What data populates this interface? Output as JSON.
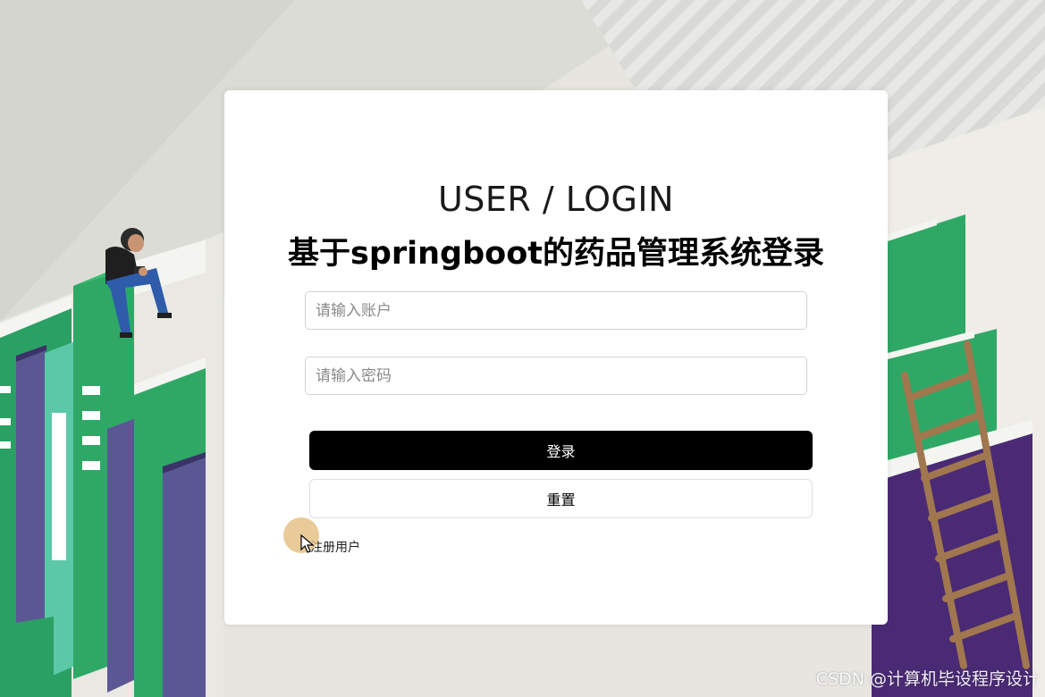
{
  "login": {
    "title": "USER / LOGIN",
    "subtitle": "基于springboot的药品管理系统登录",
    "account_placeholder": "请输入账户",
    "password_placeholder": "请输入密码",
    "login_label": "登录",
    "reset_label": "重置",
    "register_label": "注册用户"
  },
  "watermark": "CSDN @计算机毕设程序设计",
  "colors": {
    "login_button_bg": "#000000",
    "book_green": "#2fa866",
    "book_purple": "#5a3a8a",
    "ladder": "#a0774f"
  },
  "decor": {
    "illustration": "books-stack",
    "person": "person-reading-phone",
    "ladder": "ladder"
  }
}
